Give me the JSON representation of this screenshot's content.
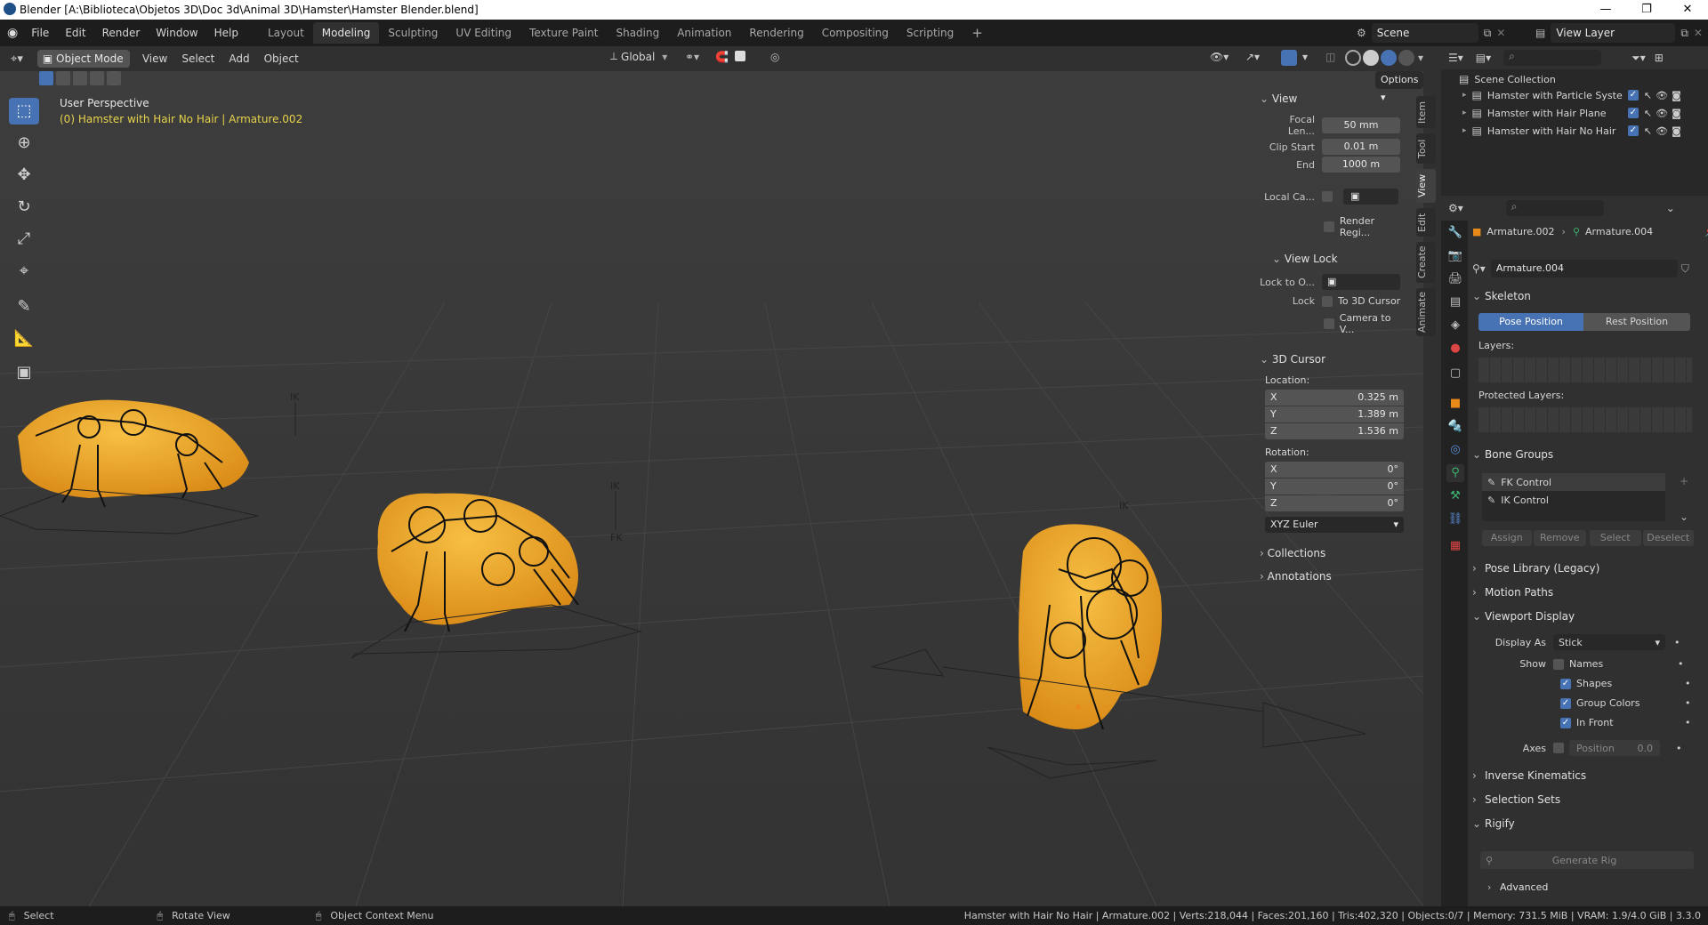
{
  "window": {
    "title": "Blender [A:\\Biblioteca\\Objetos 3D\\Doc 3d\\Animal 3D\\Hamster\\Hamster Blender.blend]"
  },
  "menu": {
    "items": [
      "File",
      "Edit",
      "Render",
      "Window",
      "Help"
    ]
  },
  "workspaces": [
    "Layout",
    "Modeling",
    "Sculpting",
    "UV Editing",
    "Texture Paint",
    "Shading",
    "Animation",
    "Rendering",
    "Compositing",
    "Scripting"
  ],
  "workspace_add": "+",
  "scene": {
    "name": "Scene",
    "view_layer": "View Layer"
  },
  "viewport_header": {
    "mode": "Object Mode",
    "menus": [
      "View",
      "Select",
      "Add",
      "Object"
    ],
    "orientation": "Global",
    "options": "Options"
  },
  "viewport": {
    "perspective": "User Perspective",
    "object_info": "(0) Hamster with Hair No Hair | Armature.002",
    "ik_label": "IK",
    "fk_label": "FK"
  },
  "npanel": {
    "tabs": [
      "Item",
      "Tool",
      "View",
      "Edit",
      "Create",
      "Animate"
    ],
    "view_section": "View",
    "focal_length_label": "Focal Len...",
    "focal_length": "50 mm",
    "clip_start_label": "Clip Start",
    "clip_start": "0.01 m",
    "clip_end_label": "End",
    "clip_end": "1000 m",
    "local_camera_label": "Local Ca...",
    "render_region": "Render Regi...",
    "view_lock_section": "View Lock",
    "lock_to_object_label": "Lock to O...",
    "lock_label": "Lock",
    "to_3d_cursor": "To 3D Cursor",
    "camera_to_view": "Camera to V...",
    "cursor_section": "3D Cursor",
    "location_label": "Location:",
    "loc_x_label": "X",
    "loc_x": "0.325 m",
    "loc_y_label": "Y",
    "loc_y": "1.389 m",
    "loc_z_label": "Z",
    "loc_z": "1.536 m",
    "rotation_label": "Rotation:",
    "rot_x_label": "X",
    "rot_x": "0°",
    "rot_y_label": "Y",
    "rot_y": "0°",
    "rot_z_label": "Z",
    "rot_z": "0°",
    "rotation_mode": "XYZ Euler",
    "collections": "Collections",
    "annotations": "Annotations"
  },
  "outliner": {
    "root": "Scene Collection",
    "items": [
      "Hamster with Particle System",
      "Hamster with Hair Plane",
      "Hamster with Hair No Hair"
    ]
  },
  "properties": {
    "breadcrumb_object": "Armature.002",
    "breadcrumb_data": "Armature.004",
    "data_name": "Armature.004",
    "skeleton": "Skeleton",
    "pose_position": "Pose Position",
    "rest_position": "Rest Position",
    "layers": "Layers:",
    "protected_layers": "Protected Layers:",
    "bone_groups": "Bone Groups",
    "bone_group_items": [
      "FK Control",
      "IK Control"
    ],
    "assign": "Assign",
    "remove": "Remove",
    "select": "Select",
    "deselect": "Deselect",
    "pose_library": "Pose Library (Legacy)",
    "motion_paths": "Motion Paths",
    "viewport_display": "Viewport Display",
    "display_as_label": "Display As",
    "display_as": "Stick",
    "show_label": "Show",
    "names": "Names",
    "shapes": "Shapes",
    "group_colors": "Group Colors",
    "in_front": "In Front",
    "axes_label": "Axes",
    "position_label": "Position",
    "position_value": "0.0",
    "inverse_kinematics": "Inverse Kinematics",
    "selection_sets": "Selection Sets",
    "rigify": "Rigify",
    "generate_rig": "Generate Rig",
    "advanced": "Advanced"
  },
  "statusbar": {
    "select": "Select",
    "rotate": "Rotate View",
    "context": "Object Context Menu",
    "stats": "Hamster with Hair No Hair | Armature.002 | Verts:218,044 | Faces:201,160 | Tris:402,320 | Objects:0/7 | Memory: 731.5 MiB | VRAM: 1.9/4.0 GiB | 3.3.0"
  },
  "colors": {
    "accent": "#4772b3",
    "hamster": "#e8a52a",
    "header": "#1d1d1d",
    "viewport": "#393939",
    "info_text": "#e6d24a"
  }
}
